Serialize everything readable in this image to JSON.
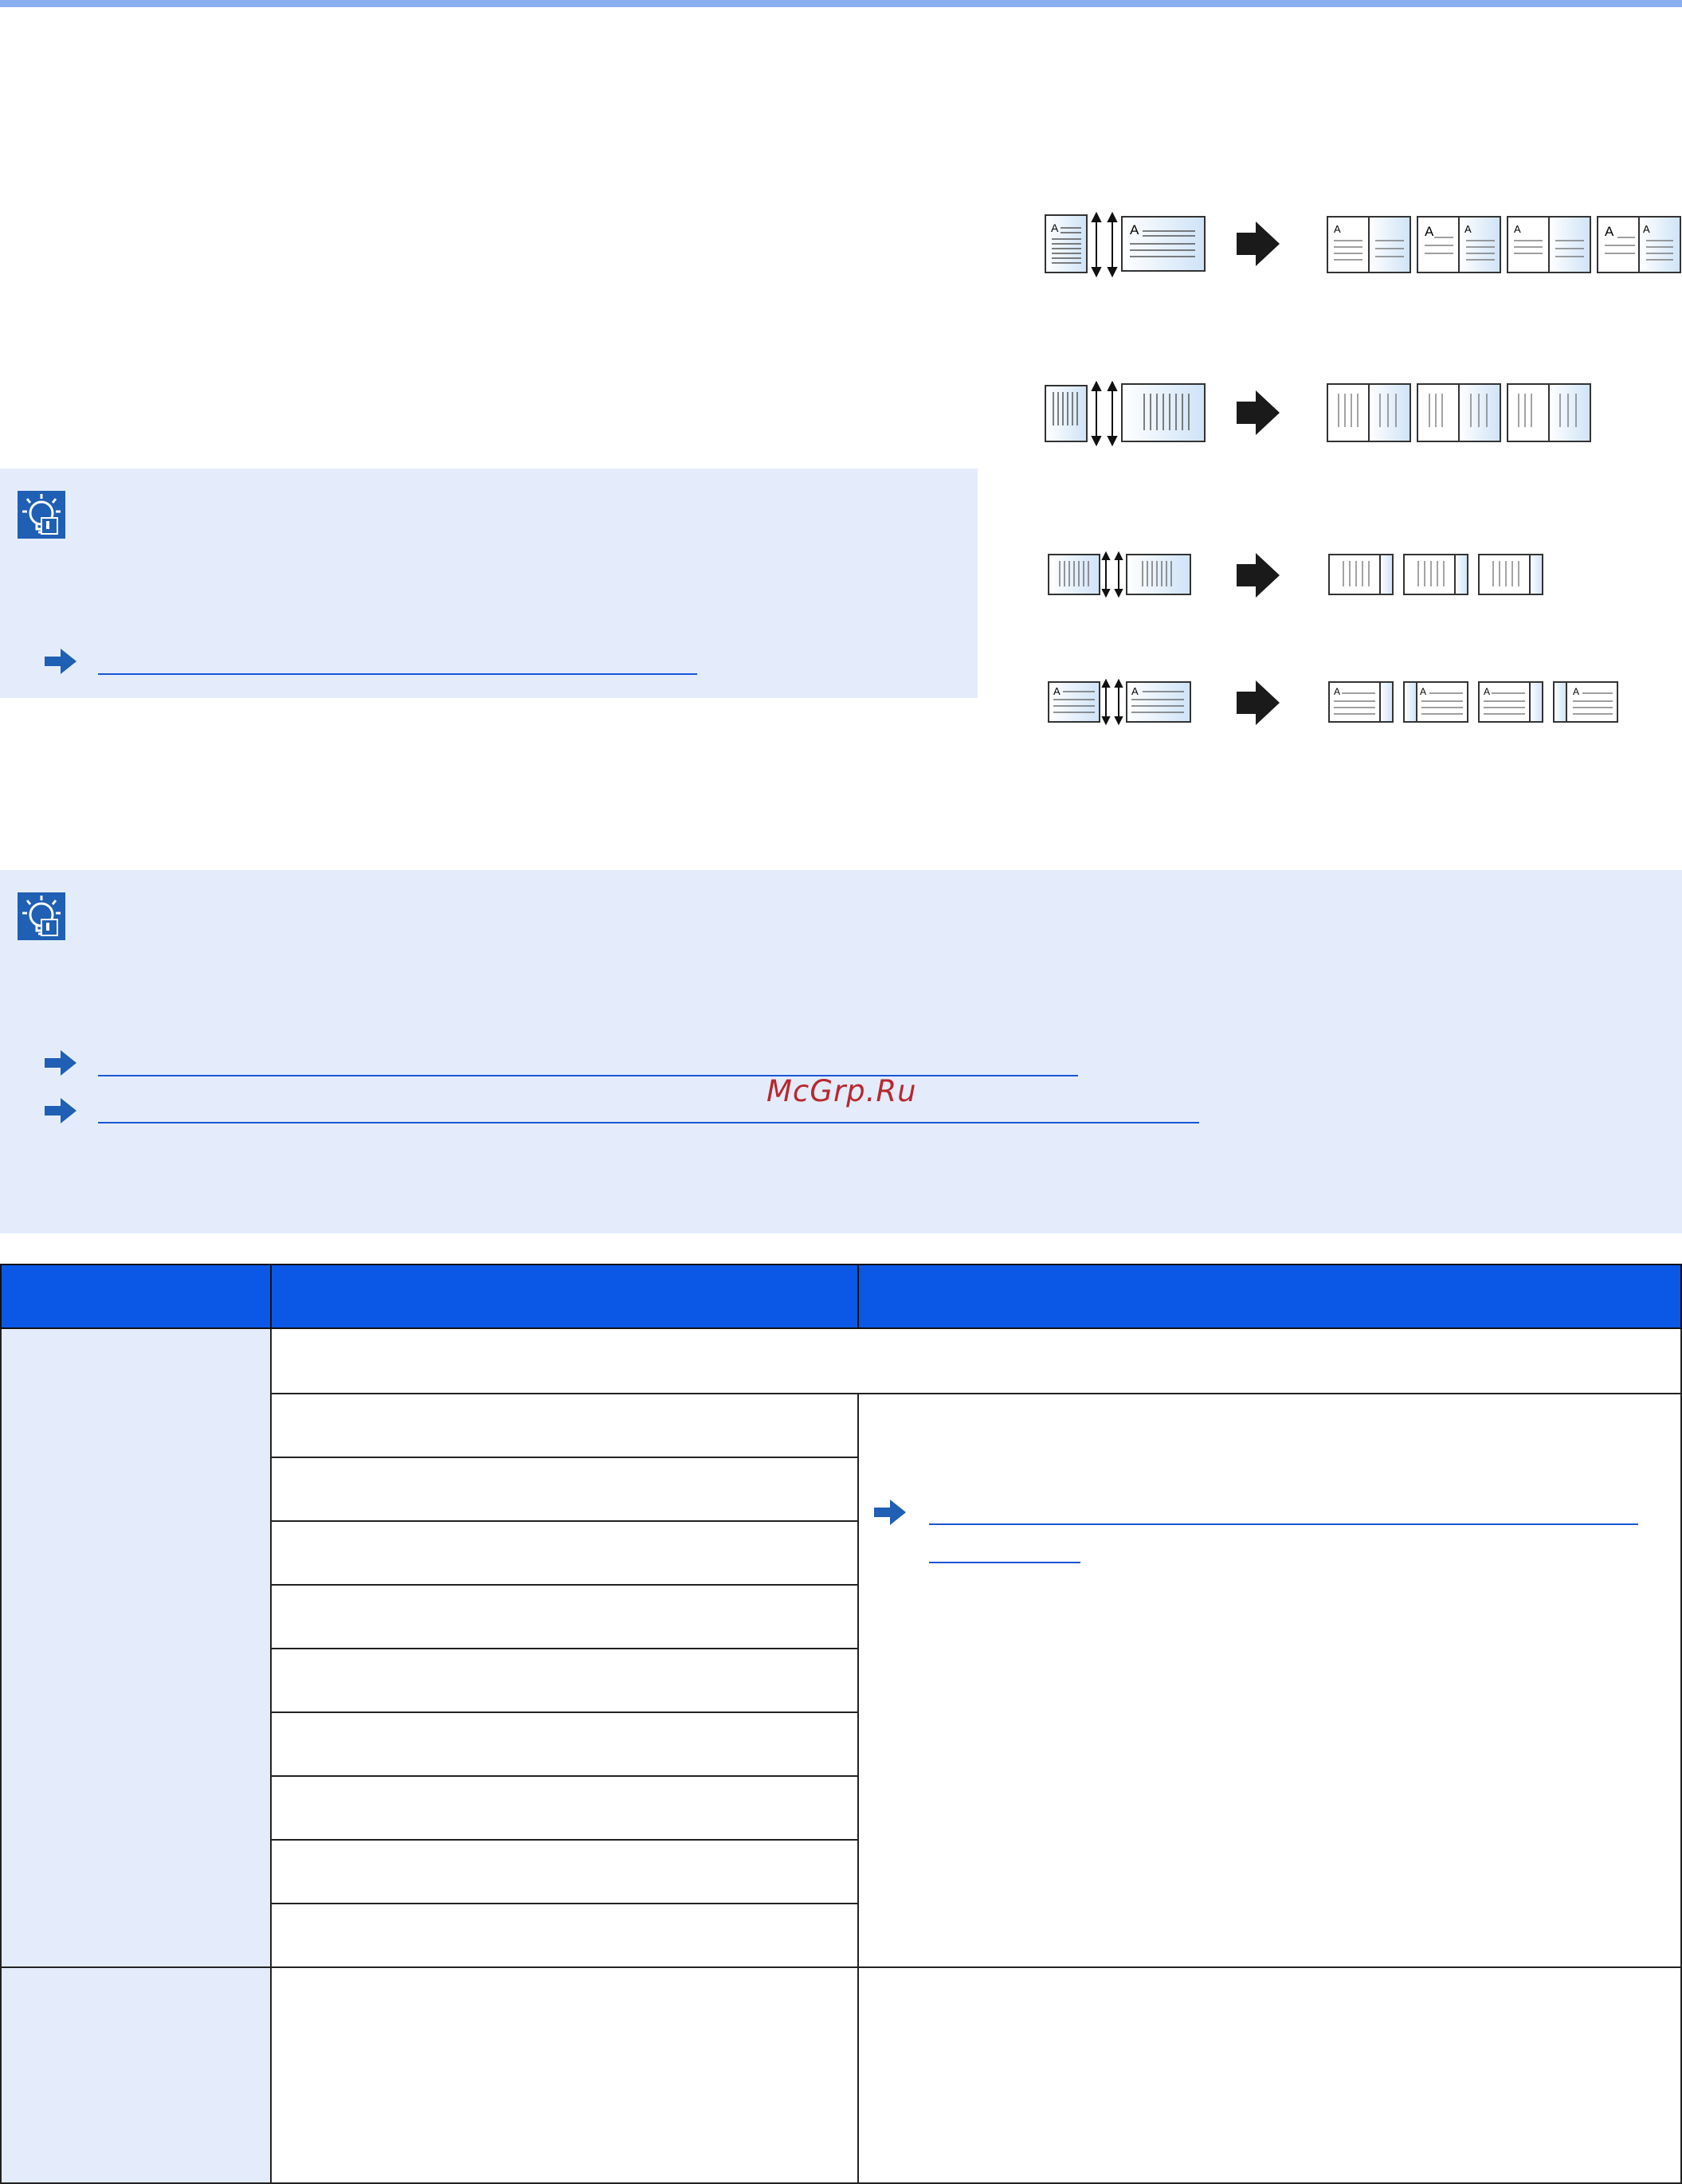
{
  "page": {
    "watermark": "McGrp.Ru"
  },
  "icons": {
    "note": "lightbulb-icon",
    "link": "arrow-right-icon",
    "diagram_arrow": "arrow-right-icon"
  },
  "colors": {
    "top_bar": "#8aaef0",
    "note_background": "#e4ecfb",
    "table_header": "#0b58e6",
    "link": "#1a56d6",
    "watermark": "#b8282f"
  },
  "notes": [
    {
      "name": "note-top",
      "links": 1
    },
    {
      "name": "note-bottom",
      "links": 2
    }
  ],
  "diagrams": [
    {
      "name": "portrait-originals-to-booklet",
      "outputs": 4
    },
    {
      "name": "landscape-originals-to-booklet",
      "outputs": 3
    },
    {
      "name": "small-landscape-to-booklet",
      "outputs": 3
    },
    {
      "name": "small-portrait-to-booklet",
      "outputs": 4
    }
  ],
  "table": {
    "header_columns": 3,
    "option_rows": 9
  }
}
